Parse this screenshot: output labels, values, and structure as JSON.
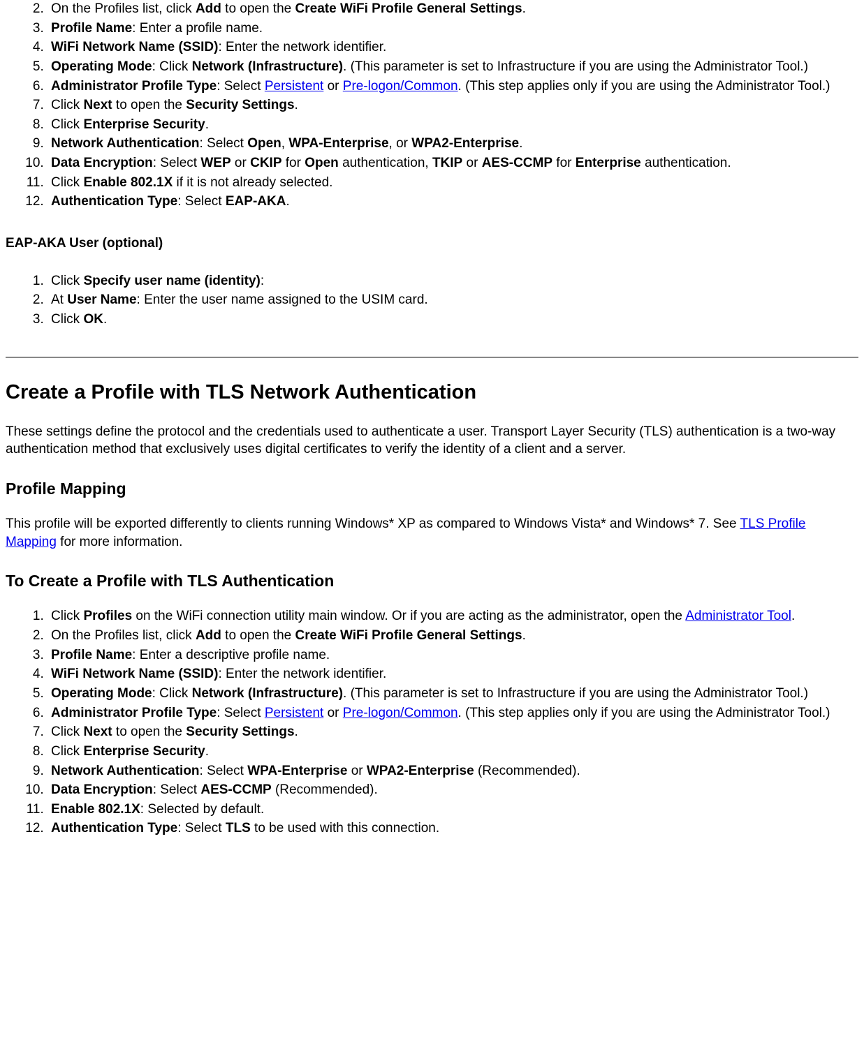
{
  "aka_steps": {
    "start": 2,
    "items": [
      {
        "t1": "On the Profiles list, click ",
        "b1": "Add",
        "t2": " to open the ",
        "b2": "Create WiFi Profile General Settings",
        "t3": "."
      },
      {
        "b1": "Profile Name",
        "t1": ": Enter a profile name."
      },
      {
        "b1": "WiFi Network Name (SSID)",
        "t1": ": Enter the network identifier."
      },
      {
        "b1": "Operating Mode",
        "t1": ": Click ",
        "b2": "Network (Infrastructure)",
        "t2": ". (This parameter is set to Infrastructure if you are using the Administrator Tool.)"
      },
      {
        "b1": "Administrator Profile Type",
        "t1": ": Select ",
        "a1": "Persistent",
        "t2": " or ",
        "a2": "Pre-logon/Common",
        "t3": ". (This step applies only if you are using the Administrator Tool.)"
      },
      {
        "t1": "Click ",
        "b1": "Next",
        "t2": " to open the ",
        "b2": "Security Settings",
        "t3": "."
      },
      {
        "t1": "Click ",
        "b1": "Enterprise Security",
        "t2": "."
      },
      {
        "b1": "Network Authentication",
        "t1": ": Select ",
        "b2": "Open",
        "t2": ", ",
        "b3": "WPA-Enterprise",
        "t3": ", or ",
        "b4": "WPA2-Enterprise",
        "t4": "."
      },
      {
        "b1": "Data Encryption",
        "t1": ": Select ",
        "b2": "WEP",
        "t2": " or ",
        "b3": "CKIP",
        "t3": " for ",
        "b4": "Open",
        "t4": " authentication, ",
        "b5": "TKIP",
        "t5": " or ",
        "b6": "AES-CCMP",
        "t6": " for ",
        "b7": "Enterprise",
        "t7": " authentication."
      },
      {
        "t1": "Click ",
        "b1": "Enable 802.1X",
        "t2": " if it is not already selected."
      },
      {
        "b1": "Authentication Type",
        "t1": ": Select ",
        "b2": "EAP-AKA",
        "t2": "."
      }
    ]
  },
  "aka_user_heading": "EAP-AKA User (optional)",
  "aka_user_steps": {
    "start": 1,
    "items": [
      {
        "t1": "Click ",
        "b1": "Specify user name (identity)",
        "t2": ":"
      },
      {
        "t1": "At ",
        "b1": "User Name",
        "t2": ": Enter the user name assigned to the USIM card."
      },
      {
        "t1": "Click ",
        "b1": "OK",
        "t2": "."
      }
    ]
  },
  "tls_heading": "Create a Profile with TLS Network Authentication",
  "tls_intro": "These settings define the protocol and the credentials used to authenticate a user. Transport Layer Security (TLS) authentication is a two-way authentication method that exclusively uses digital certificates to verify the identity of a client and a server.",
  "mapping_heading": "Profile Mapping",
  "mapping_text1": "This profile will be exported differently to clients running Windows* XP as compared to Windows Vista* and Windows* 7. See ",
  "mapping_link": "TLS Profile Mapping",
  "mapping_text2": " for more information.",
  "tls_create_heading": "To Create a Profile with TLS Authentication",
  "tls_steps": {
    "start": 1,
    "items": [
      {
        "t1": "Click ",
        "b1": "Profiles",
        "t2": " on the WiFi connection utility main window. Or if you are acting as the administrator, open the ",
        "a1": "Administrator Tool",
        "t3": "."
      },
      {
        "t1": "On the Profiles list, click ",
        "b1": "Add",
        "t2": " to open the ",
        "b2": "Create WiFi Profile General Settings",
        "t3": "."
      },
      {
        "b1": "Profile Name",
        "t1": ": Enter a descriptive profile name."
      },
      {
        "b1": "WiFi Network Name (SSID)",
        "t1": ": Enter the network identifier."
      },
      {
        "b1": "Operating Mode",
        "t1": ": Click ",
        "b2": "Network (Infrastructure)",
        "t2": ". (This parameter is set to Infrastructure if you are using the Administrator Tool.)"
      },
      {
        "b1": "Administrator Profile Type",
        "t1": ": Select ",
        "a1": "Persistent",
        "t2": " or ",
        "a2": "Pre-logon/Common",
        "t3": ". (This step applies only if you are using the Administrator Tool.)"
      },
      {
        "t1": "Click ",
        "b1": "Next",
        "t2": " to open the ",
        "b2": "Security Settings",
        "t3": "."
      },
      {
        "t1": "Click ",
        "b1": "Enterprise Security",
        "t2": "."
      },
      {
        "b1": "Network Authentication",
        "t1": ": Select ",
        "b2": "WPA-Enterprise",
        "t2": " or ",
        "b3": "WPA2-Enterprise",
        "t3": " (Recommended)."
      },
      {
        "b1": "Data Encryption",
        "t1": ": Select ",
        "b2": "AES-CCMP",
        "t2": " (Recommended)."
      },
      {
        "b1": "Enable 802.1X",
        "t1": ": Selected by default."
      },
      {
        "b1": "Authentication Type",
        "t1": ": Select ",
        "b2": "TLS",
        "t2": " to be used with this connection."
      }
    ]
  }
}
